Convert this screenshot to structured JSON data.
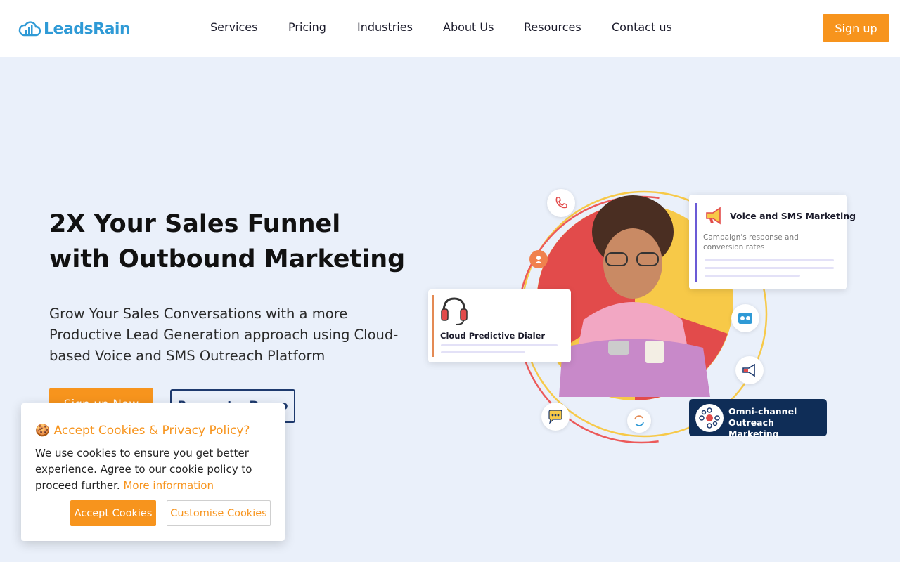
{
  "brand": {
    "logo_text": "LeadsRain",
    "accent_color": "#f7941d",
    "logo_color": "#2f9ad6"
  },
  "nav": {
    "items": [
      {
        "label": "Services"
      },
      {
        "label": "Pricing"
      },
      {
        "label": "Industries"
      },
      {
        "label": "About Us"
      },
      {
        "label": "Resources"
      },
      {
        "label": "Contact us"
      }
    ],
    "signup_label": "Sign up"
  },
  "hero": {
    "title_line1": "2X Your Sales Funnel",
    "title_line2": "with Outbound Marketing",
    "subtitle": "Grow Your Sales Conversations with a more Productive Lead Generation approach using Cloud-based Voice and SMS Outreach Platform",
    "primary_button": "Sign up Now",
    "secondary_button": "Request a Demo"
  },
  "illustration": {
    "voice_card_title": "Voice and SMS Marketing",
    "voice_card_desc": "Campaign's response and conversion rates",
    "dialer_card_title": "Cloud Predictive Dialer",
    "omni_card_title": "Omni-channel Outreach Marketing",
    "icons": [
      "phone-icon",
      "user-icon",
      "voicemail-icon",
      "megaphone-icon",
      "chat-icon",
      "sync-icon",
      "headset-icon",
      "network-icon"
    ]
  },
  "cookie": {
    "title": "🍪 Accept Cookies & Privacy Policy?",
    "text": "We use cookies to ensure you get better experience. Agree to our cookie policy to proceed further.",
    "link": "More information",
    "accept_label": "Accept Cookies",
    "customise_label": "Customise Cookies"
  }
}
